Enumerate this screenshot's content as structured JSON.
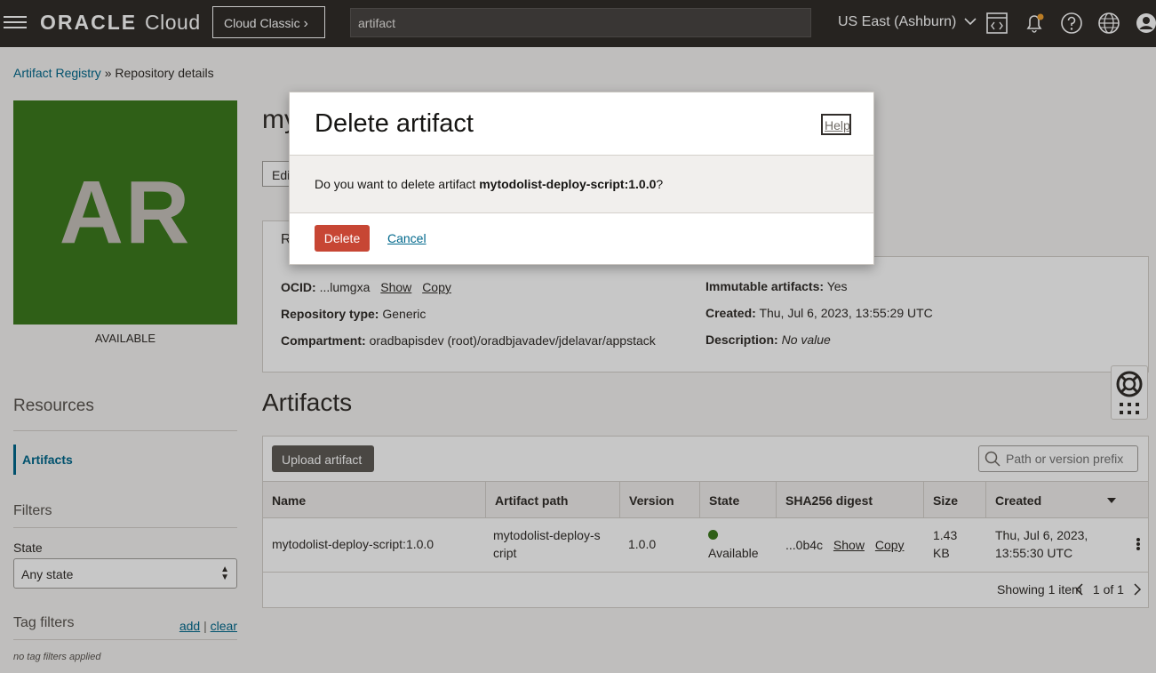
{
  "topbar": {
    "brand": "ORACLE",
    "cloud": "Cloud",
    "cloud_classic_label": "Cloud Classic",
    "search_value": "artifact",
    "region": "US East (Ashburn)"
  },
  "breadcrumb": {
    "root": "Artifact Registry",
    "separator": "»",
    "current": "Repository details"
  },
  "repository": {
    "tile_initials": "AR",
    "status": "AVAILABLE",
    "title_partial": "my",
    "edit_partial": "Edi",
    "tab_partial": "R",
    "ocid_label": "OCID:",
    "ocid_value": "...lumgxa",
    "show_label": "Show",
    "copy_label": "Copy",
    "repo_type_label": "Repository type:",
    "repo_type_value": "Generic",
    "compartment_label": "Compartment:",
    "compartment_value": "oradbapisdev (root)/oradbjavadev/jdelavar/appstack",
    "immutable_label": "Immutable artifacts:",
    "immutable_value": "Yes",
    "created_label": "Created:",
    "created_value": "Thu, Jul 6, 2023, 13:55:29 UTC",
    "description_label": "Description:",
    "description_value": "No value"
  },
  "sidebar": {
    "resources_heading": "Resources",
    "artifacts_item": "Artifacts",
    "filters_heading": "Filters",
    "state_label": "State",
    "state_value": "Any state",
    "tag_filters_heading": "Tag filters",
    "tag_add": "add",
    "tag_sep": "|",
    "tag_clear": "clear",
    "no_tags": "no tag filters applied"
  },
  "artifacts": {
    "heading": "Artifacts",
    "upload_label": "Upload artifact",
    "search_placeholder": "Path or version prefix",
    "columns": [
      "Name",
      "Artifact path",
      "Version",
      "State",
      "SHA256 digest",
      "Size",
      "Created"
    ],
    "rows": [
      {
        "name": "mytodolist-deploy-script:1.0.0",
        "path_line1": "mytodolist-deploy-s",
        "path_line2": "cript",
        "version": "1.0.0",
        "state": "Available",
        "digest": "...0b4c",
        "show": "Show",
        "copy": "Copy",
        "size_line1": "1.43",
        "size_line2": "KB",
        "created_line1": "Thu, Jul 6, 2023,",
        "created_line2": "13:55:30 UTC"
      }
    ],
    "showing": "Showing 1 item",
    "page": "1 of 1"
  },
  "modal": {
    "title": "Delete artifact",
    "help": "Help",
    "prompt_prefix": "Do you want to delete artifact ",
    "artifact_name": "mytodolist-deploy-script:1.0.0",
    "prompt_suffix": "?",
    "delete_label": "Delete",
    "cancel_label": "Cancel"
  },
  "colors": {
    "topbar": "#312d2a",
    "tile": "#3d7a1e",
    "link": "#00688c",
    "danger": "#c74634",
    "available": "#3d7a1e"
  },
  "icons": {
    "menu": "hamburger-icon",
    "cloud_shell": "code-console-icon",
    "notifications": "bell-icon",
    "help": "question-icon",
    "language": "globe-icon",
    "profile": "user-icon",
    "support": "lifebuoy-icon",
    "apps": "grid-icon"
  }
}
